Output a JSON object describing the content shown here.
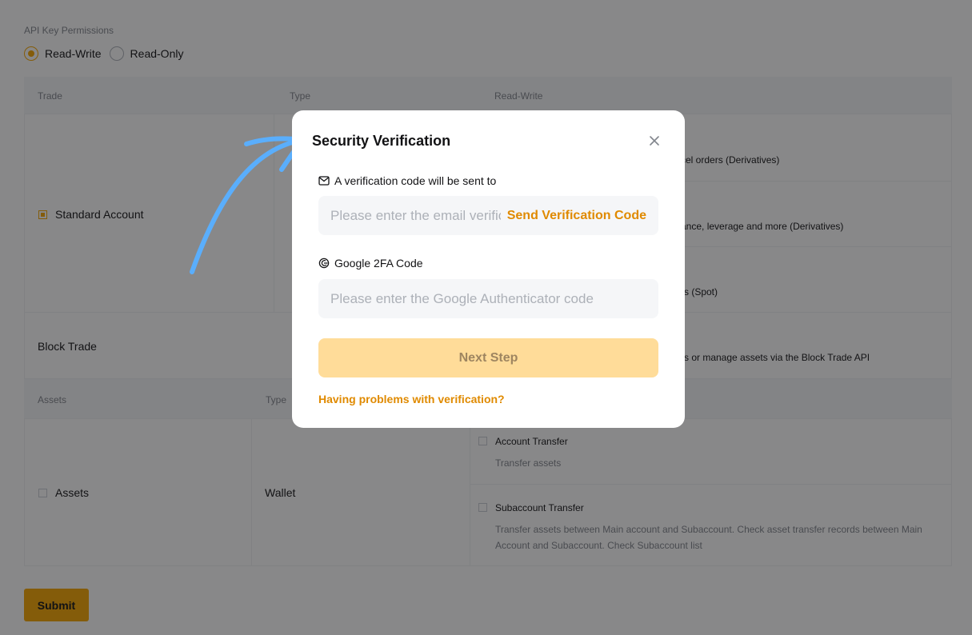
{
  "permissions": {
    "title": "API Key Permissions",
    "options": [
      {
        "label": "Read-Write",
        "selected": true
      },
      {
        "label": "Read-Only",
        "selected": false
      }
    ]
  },
  "trade_table": {
    "headers": [
      "Trade",
      "Type",
      "Read-Write"
    ],
    "standard_account": "Standard Account",
    "row1_partial": "cel orders (Derivatives)",
    "row2_partial": "ance, leverage and more (Derivatives)",
    "row3_partial": "rs (Spot)",
    "block_trade": "Block Trade",
    "block_trade_partial": "rs or manage assets via the Block Trade API"
  },
  "assets_table": {
    "headers": [
      "Assets",
      "Type"
    ],
    "assets_label": "Assets",
    "type_value": "Wallet",
    "items": [
      {
        "title": "Account Transfer",
        "desc": "Transfer assets"
      },
      {
        "title": "Subaccount Transfer",
        "desc_line1": "Transfer assets between Main account and Subaccount. Check asset transfer records between Main",
        "desc_line2": "Account and Subaccount. Check Subaccount list"
      }
    ]
  },
  "submit_label": "Submit",
  "modal": {
    "title": "Security Verification",
    "email_label": "A verification code will be sent to",
    "email_placeholder": "Please enter the email verification code",
    "send_code": "Send Verification Code",
    "twofa_label": "Google 2FA Code",
    "twofa_placeholder": "Please enter the Google Authenticator code",
    "next_step": "Next Step",
    "help_link": "Having problems with verification?"
  },
  "colors": {
    "accent": "#f7a600",
    "link": "#e08a00",
    "annotation_arrow": "#5aaefc"
  }
}
